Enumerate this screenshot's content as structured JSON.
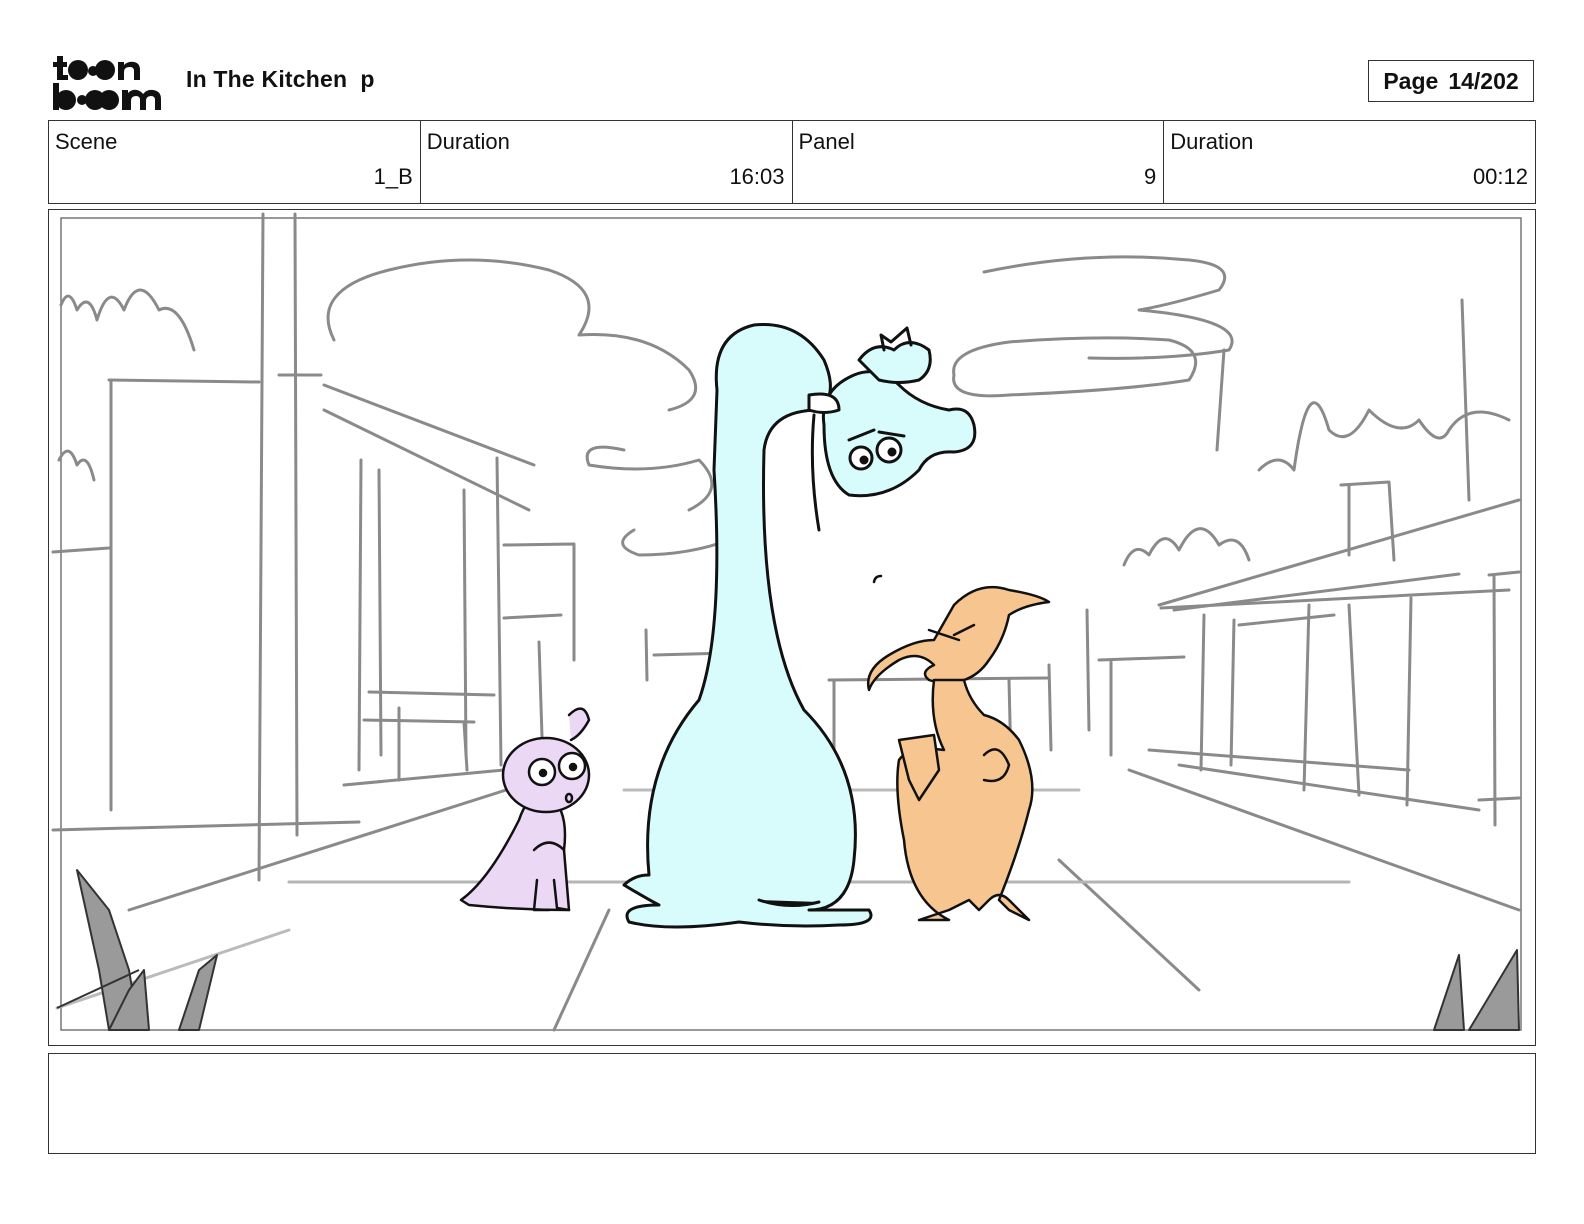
{
  "header": {
    "project_title": "In The Kitchen  p",
    "page_label": "Page",
    "page_value": "14/202"
  },
  "info": {
    "scene_label": "Scene",
    "scene_value": "1_B",
    "scene_duration_label": "Duration",
    "scene_duration_value": "16:03",
    "panel_label": "Panel",
    "panel_value": "9",
    "panel_duration_label": "Duration",
    "panel_duration_value": "00:12"
  },
  "notes": {
    "text": ""
  },
  "colors": {
    "sketch_gray": "#8a8a8a",
    "dino_fill": "#d8fbfb",
    "bird_fill": "#f7c590",
    "kid_fill": "#ead8f4",
    "outline": "#111111"
  }
}
